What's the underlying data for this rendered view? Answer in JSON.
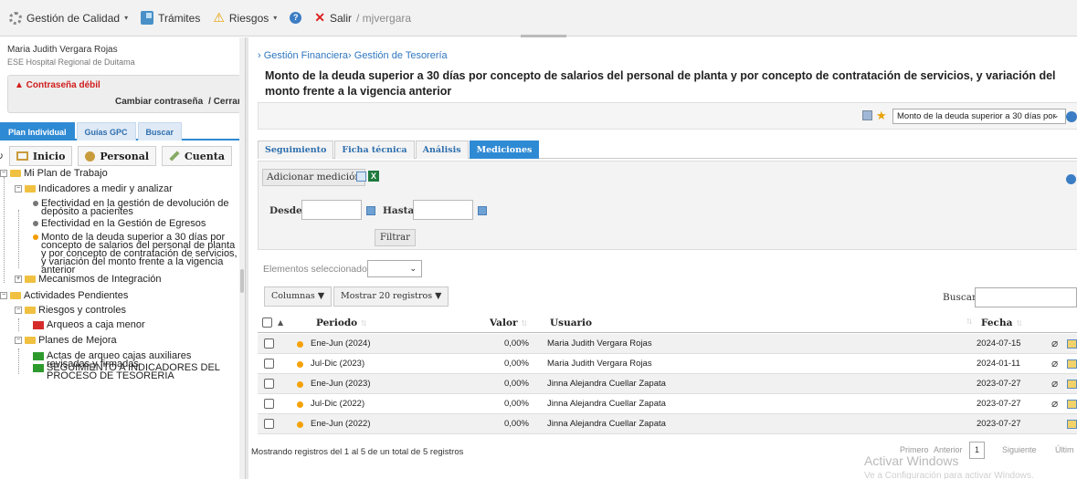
{
  "topbar": {
    "menus": [
      {
        "label": "Gestión de Calidad",
        "caret": "▾"
      },
      {
        "label": "Trámites"
      },
      {
        "label": "Riesgos",
        "caret": "▾"
      }
    ],
    "exit_label": "Salir",
    "user_suffix": "/ mjvergara"
  },
  "left": {
    "user_name": "Maria Judith Vergara Rojas",
    "org": "ESE Hospital Regional de Duitama",
    "pwd_warning": "▲ Contraseña débil",
    "change_pwd": "Cambiar contraseña",
    "close": "/ Cerrar",
    "tabs": [
      "Plan Individual",
      "Guías GPC",
      "Buscar"
    ],
    "buttons": {
      "home": "Inicio",
      "personal": "Personal",
      "account": "Cuenta"
    },
    "tree": {
      "plan": "Mi Plan de Trabajo",
      "indicators": "Indicadores a medir y analizar",
      "ind1": "Efectividad en la gestión de devolución de depósito a pacientes",
      "ind2": "Efectividad en la Gestión de Egresos",
      "ind3": "Monto de la deuda superior a 30 días por concepto de salarios del personal de planta y por concepto de contratación de servicios, y variación del monto frente a la vigencia anterior",
      "integration": "Mecanismos de Integración",
      "pending": "Actividades Pendientes",
      "risks": "Riesgos y controles",
      "arqueos": "Arqueos a caja menor",
      "plans": "Planes de Mejora",
      "actas": "Actas de arqueo cajas auxiliares revisadas y firmadas",
      "seguimiento": "SEGUIMIENTO A INDICADORES DEL PROCESO DE TESORERIA"
    }
  },
  "main": {
    "breadcrumb": "› Gestión Financiera› Gestión de Tesorería",
    "title": "Monto de la deuda superior a 30 días por concepto de salarios del personal de planta y por concepto de contratación de servicios, y variación del monto frente a la vigencia anterior",
    "indicator_select": "Monto de la deuda superior a 30 días por",
    "tabs": [
      "Seguimiento",
      "Ficha técnica",
      "Análisis",
      "Mediciones"
    ],
    "active_tab": "Mediciones",
    "add_measurement": "Adicionar medición",
    "from_label": "Desde",
    "to_label": "Hasta",
    "filter_button": "Filtrar",
    "selected_label": "Elementos seleccionados",
    "columns_button": "Columnas ▼",
    "show_button": "Mostrar 20 registros ▼",
    "search_label": "Buscar:",
    "headers": {
      "period": "Periodo",
      "value": "Valor",
      "user": "Usuario",
      "date": "Fecha"
    },
    "rows": [
      {
        "period": "Ene-Jun (2024)",
        "value": "0,00%",
        "user": "Maria Judith Vergara Rojas",
        "date": "2024-07-15",
        "attachment": true
      },
      {
        "period": "Jul-Dic (2023)",
        "value": "0,00%",
        "user": "Maria Judith Vergara Rojas",
        "date": "2024-01-11",
        "attachment": true
      },
      {
        "period": "Ene-Jun (2023)",
        "value": "0,00%",
        "user": "Jinna Alejandra Cuellar Zapata",
        "date": "2023-07-27",
        "attachment": true
      },
      {
        "period": "Jul-Dic (2022)",
        "value": "0,00%",
        "user": "Jinna Alejandra Cuellar Zapata",
        "date": "2023-07-27",
        "attachment": true
      },
      {
        "period": "Ene-Jun (2022)",
        "value": "0,00%",
        "user": "Jinna Alejandra Cuellar Zapata",
        "date": "2023-07-27",
        "attachment": false
      }
    ],
    "footer_info": "Mostrando registros del 1 al 5 de un total de 5 registros",
    "pager": {
      "first": "Primero",
      "prev": "Anterior",
      "page": "1",
      "next": "Siguiente",
      "last": "Últim"
    },
    "watermark": {
      "line1": "Activar Windows",
      "line2": "Ve a Configuración para activar Windows."
    }
  },
  "colors": {
    "accent": "#2f8ad4",
    "link": "#2f77c0",
    "warning": "#d01c1c",
    "status_dot": "#f5a20a"
  }
}
